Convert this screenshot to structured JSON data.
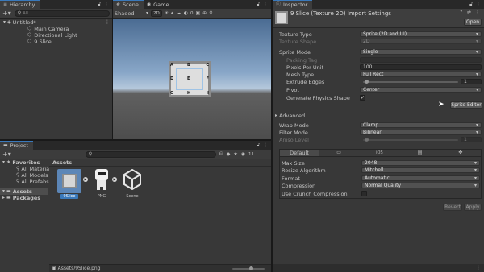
{
  "hierarchy": {
    "tab": "Hierarchy",
    "search_placeholder": "All",
    "scene": "Untitled*",
    "items": [
      "Main Camera",
      "Directional Light",
      "9 Slice"
    ]
  },
  "scene_view": {
    "tab_scene": "Scene",
    "tab_game": "Game",
    "shading": "Shaded",
    "mode_2d": "2D",
    "gizmo_count": "0",
    "slice_labels": {
      "a": "A",
      "b": "B",
      "c": "C",
      "d": "D",
      "e": "E",
      "f": "F",
      "g": "G",
      "h": "H",
      "i": "I"
    }
  },
  "project": {
    "tab": "Project",
    "favorites": "Favorites",
    "fav_items": [
      "All Materia",
      "All Models",
      "All Prefabs"
    ],
    "assets": "Assets",
    "packages": "Packages",
    "breadcrumb": "Assets",
    "count": "11",
    "files": [
      {
        "name": "9Slice"
      },
      {
        "name": "PNG"
      },
      {
        "name": "Scene"
      }
    ],
    "status_path": "Assets/9Slice.png"
  },
  "inspector": {
    "tab": "Inspector",
    "title": "9 Slice (Texture 2D) Import Settings",
    "open_label": "Open",
    "texture_type_label": "Texture Type",
    "texture_type": "Sprite (2D and UI)",
    "texture_shape_label": "Texture Shape",
    "texture_shape": "2D",
    "sprite_mode_label": "Sprite Mode",
    "sprite_mode": "Single",
    "packing_tag_label": "Packing Tag",
    "ppu_label": "Pixels Per Unit",
    "ppu": "100",
    "mesh_type_label": "Mesh Type",
    "mesh_type": "Full Rect",
    "extrude_label": "Extrude Edges",
    "extrude": "1",
    "pivot_label": "Pivot",
    "pivot": "Center",
    "physics_label": "Generate Physics Shape",
    "sprite_editor": "Sprite Editor",
    "advanced": "Advanced",
    "wrap_label": "Wrap Mode",
    "wrap": "Clamp",
    "filter_label": "Filter Mode",
    "filter": "Bilinear",
    "aniso_label": "Aniso Level",
    "aniso": "1",
    "platform_default": "Default",
    "max_size_label": "Max Size",
    "max_size": "2048",
    "resize_label": "Resize Algorithm",
    "resize": "Mitchell",
    "format_label": "Format",
    "format": "Automatic",
    "compression_label": "Compression",
    "compression": "Normal Quality",
    "crunch_label": "Use Crunch Compression",
    "revert": "Revert",
    "apply": "Apply"
  },
  "colors": {
    "accent": "#3a79bb",
    "sky_top": "#4e6f95",
    "ground": "#4d4d4d"
  }
}
